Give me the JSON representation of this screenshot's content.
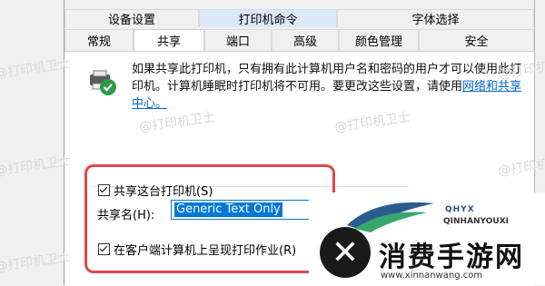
{
  "tabs_row1": [
    "设备设置",
    "打印机命令",
    "字体选择"
  ],
  "tabs_row2": [
    "常规",
    "共享",
    "端口",
    "高级",
    "颜色管理",
    "安全"
  ],
  "intro": {
    "text": "如果共享此打印机，只有拥有此计算机用户名和密码的用户才可以使用此打印机。计算机睡眠时打印机将不可用。要更改这些设置，请使用",
    "link": "网络和共享中心。"
  },
  "watermark": "@打印机卫士",
  "share_printer_label": "共享这台打印机(S)",
  "share_name_label": "共享名(H):",
  "share_name_value": "Generic  Text Only",
  "render_jobs_label": "在客户端计算机上呈现打印作业(R)",
  "overlay_logo": {
    "top": "QHYX",
    "sub": "QINHANYOUXI",
    "title": "消费手游网",
    "url": "www.xinnanwang.com"
  }
}
